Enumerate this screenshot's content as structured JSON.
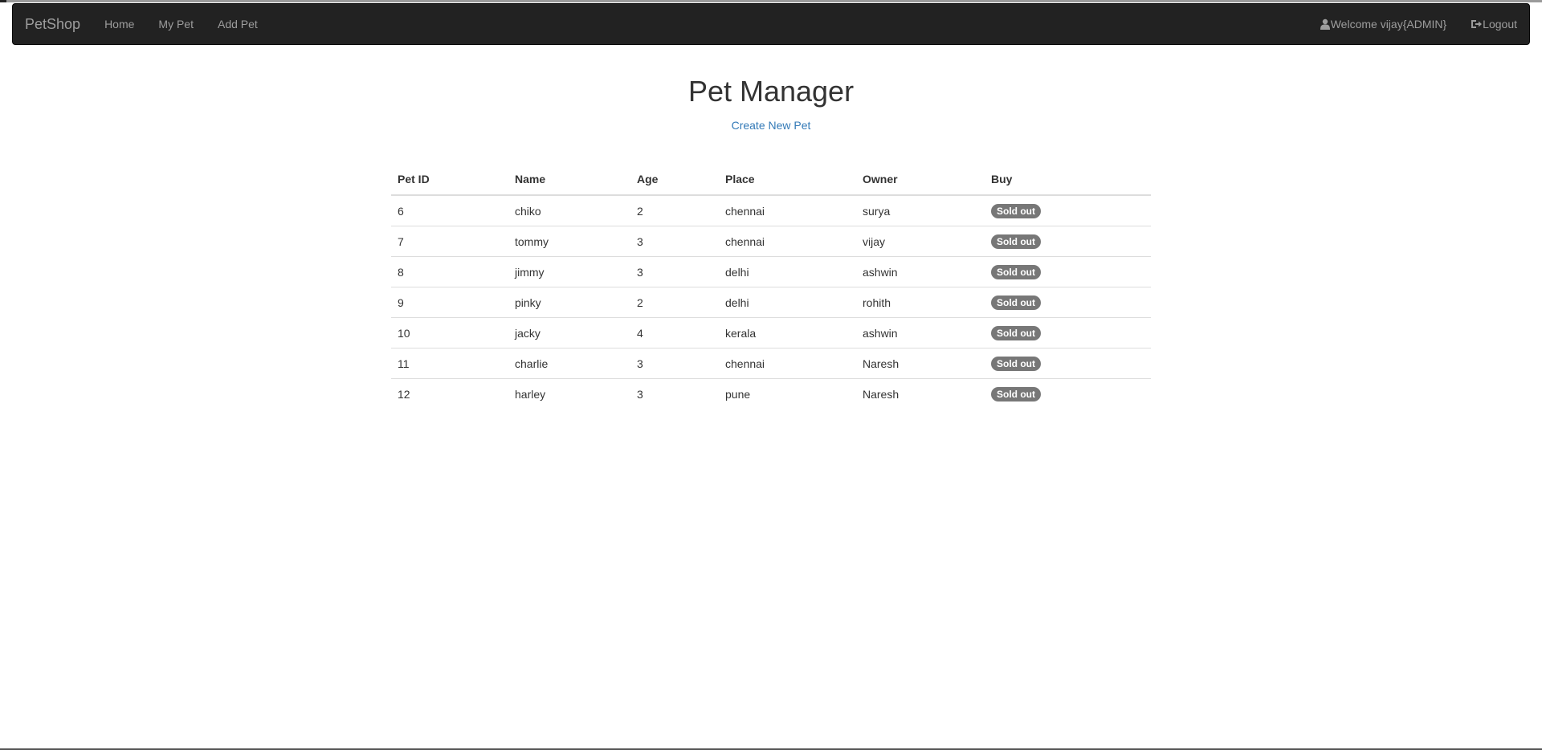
{
  "navbar": {
    "brand": "PetShop",
    "links": [
      "Home",
      "My Pet",
      "Add Pet"
    ],
    "welcome": "Welcome vijay{ADMIN}",
    "logout": "Logout",
    "icons": [
      "user-icon",
      "logout-icon"
    ]
  },
  "main": {
    "title": "Pet Manager",
    "create_link": "Create New Pet"
  },
  "table": {
    "headers": [
      "Pet ID",
      "Name",
      "Age",
      "Place",
      "Owner",
      "Buy"
    ],
    "rows": [
      [
        "6",
        "chiko",
        "2",
        "chennai",
        "surya",
        "Sold out"
      ],
      [
        "7",
        "tommy",
        "3",
        "chennai",
        "vijay",
        "Sold out"
      ],
      [
        "8",
        "jimmy",
        "3",
        "delhi",
        "ashwin",
        "Sold out"
      ],
      [
        "9",
        "pinky",
        "2",
        "delhi",
        "rohith",
        "Sold out"
      ],
      [
        "10",
        "jacky",
        "4",
        "kerala",
        "ashwin",
        "Sold out"
      ],
      [
        "11",
        "charlie",
        "3",
        "chennai",
        "Naresh",
        "Sold out"
      ],
      [
        "12",
        "harley",
        "3",
        "pune",
        "Naresh",
        "Sold out"
      ]
    ]
  },
  "colors": {
    "navbar_bg": "#222222",
    "nav_text": "#9d9d9d",
    "link": "#337ab7",
    "badge": "#777777"
  }
}
